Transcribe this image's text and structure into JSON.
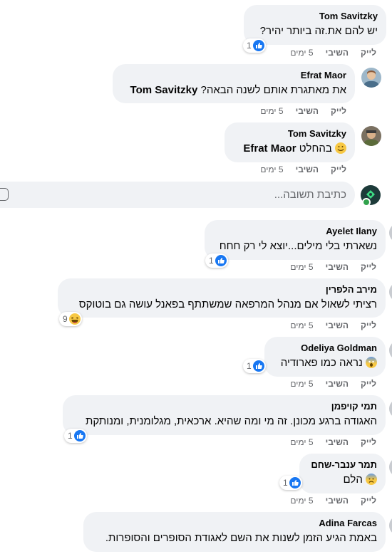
{
  "actions": {
    "like": "לייק",
    "reply": "השיבי",
    "time": "5 ימים"
  },
  "comments": [
    {
      "name": "Tom Savitzky",
      "text": "יש להם את.זה ביותר יהיר?",
      "reaction_count": "1"
    },
    {
      "name": "Efrat Maor",
      "text_tag": "Tom Savitzky",
      "text": "את מאתגרת אותם לשנה הבאה?"
    },
    {
      "name": "Tom Savitzky",
      "text_tag": "Efrat Maor",
      "text": "בהחלט"
    },
    {
      "name": "Ayelet Ilany",
      "text": "נשארתי בלי מילים...יוצא לי רק חחח",
      "reaction_count": "1"
    },
    {
      "name": "מירב הלפרין",
      "text": "רציתי לשאול אם מנהל המרפאה שמשתתף בפאנל עושה גם בוטוקס",
      "reaction_count": "9"
    },
    {
      "name": "Odeliya Goldman",
      "text": "נראה כמו פארודיה",
      "reaction_count": "1"
    },
    {
      "name": "תמי קויפמן",
      "text": "האגודה ברגע מכונן. זה מי ומה שהיא. ארכאית, מגלומנית, ומנותקת",
      "reaction_count": "1"
    },
    {
      "name": "תמר ענבר-שחם",
      "text": "הלם",
      "reaction_count": "1"
    },
    {
      "name": "Adina Farcas",
      "text": "באמת הגיע הזמן לשנות את השם לאגודת הסופרים והסופרות."
    }
  ],
  "reply_box": {
    "placeholder": "כתיבת תשובה..."
  },
  "colors": {
    "bubble": "#f0f2f5",
    "meta": "#65676b",
    "like": "#1877f2"
  }
}
